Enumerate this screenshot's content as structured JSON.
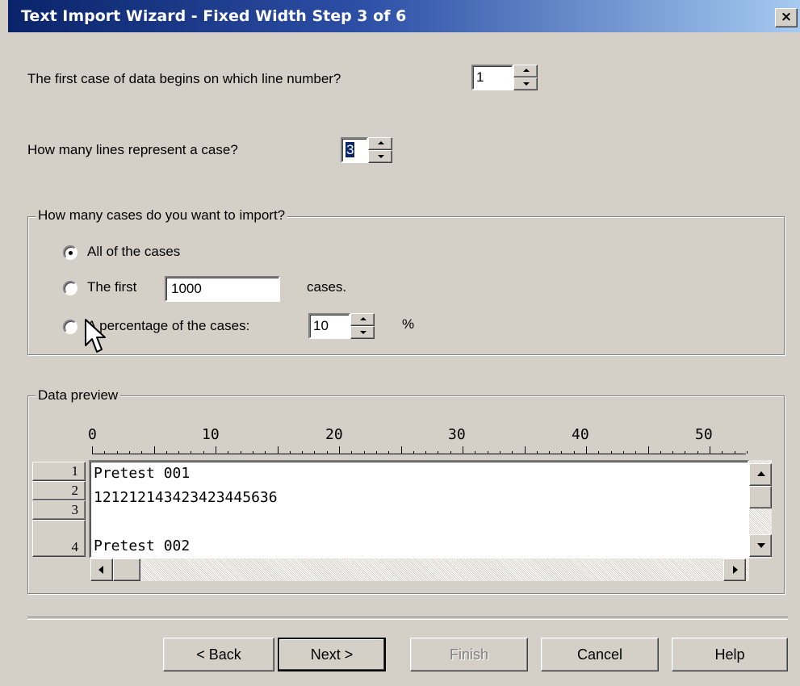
{
  "window": {
    "title": "Text Import Wizard - Fixed Width Step 3 of 6",
    "close_symbol": "×"
  },
  "first_case": {
    "label": "The first case of data begins on which line number?",
    "value": "1"
  },
  "lines_per_case": {
    "label": "How many lines represent a case?",
    "value": "3"
  },
  "import_group": {
    "legend": "How many cases do you want to import?",
    "options": [
      {
        "label": "All of the cases",
        "selected": true
      },
      {
        "label": "The first",
        "value": "1000",
        "suffix": "cases.",
        "selected": false
      },
      {
        "label": "A percentage of the cases:",
        "value": "10",
        "suffix": "%",
        "selected": false
      }
    ]
  },
  "preview": {
    "legend": "Data preview",
    "ruler": [
      "0",
      "10",
      "20",
      "30",
      "40",
      "50"
    ],
    "row_numbers": [
      "1",
      "2",
      "3",
      "4"
    ],
    "lines": [
      "Pretest 001",
      "121212143423423445636",
      "",
      "Pretest 002"
    ]
  },
  "buttons": {
    "back": "< Back",
    "next": "Next >",
    "finish": "Finish",
    "cancel": "Cancel",
    "help": "Help"
  }
}
